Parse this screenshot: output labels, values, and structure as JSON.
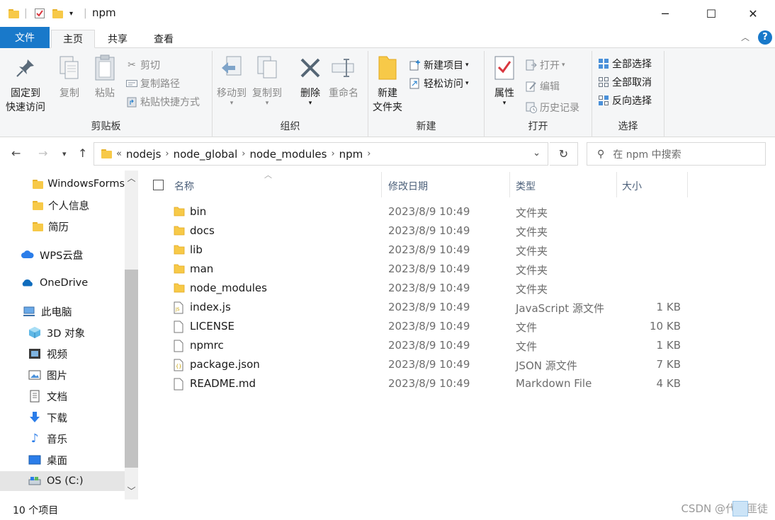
{
  "window": {
    "title": "npm",
    "controls": {
      "minimize": "─",
      "maximize": "☐",
      "close": "✕"
    }
  },
  "ribbon_tabs": [
    "文件",
    "主页",
    "共享",
    "查看"
  ],
  "ribbon": {
    "clipboard": {
      "label": "剪贴板",
      "pin_line1": "固定到",
      "pin_line2": "快速访问",
      "copy": "复制",
      "paste": "粘贴",
      "cut": "剪切",
      "copy_path": "复制路径",
      "paste_shortcut": "粘贴快捷方式"
    },
    "organize": {
      "label": "组织",
      "move_to": "移动到",
      "copy_to": "复制到",
      "delete": "删除",
      "rename": "重命名"
    },
    "new": {
      "label": "新建",
      "new_folder_line1": "新建",
      "new_folder_line2": "文件夹",
      "new_item": "新建项目",
      "easy_access": "轻松访问"
    },
    "open": {
      "label": "打开",
      "properties": "属性",
      "open": "打开",
      "edit": "编辑",
      "history": "历史记录"
    },
    "select": {
      "label": "选择",
      "select_all": "全部选择",
      "select_none": "全部取消",
      "invert": "反向选择"
    }
  },
  "address": {
    "overflow": "«",
    "crumbs": [
      "nodejs",
      "node_global",
      "node_modules",
      "npm"
    ]
  },
  "search": {
    "placeholder": "在 npm 中搜索"
  },
  "nav": [
    {
      "label": "WindowsForms",
      "icon": "folder-icon"
    },
    {
      "label": "个人信息",
      "icon": "folder-icon"
    },
    {
      "label": "简历",
      "icon": "folder-icon"
    },
    {
      "label": "WPS云盘",
      "icon": "cloud-icon"
    },
    {
      "label": "OneDrive",
      "icon": "onedrive-icon"
    },
    {
      "label": "此电脑",
      "icon": "computer-icon"
    },
    {
      "label": "3D 对象",
      "icon": "3d-objects-icon"
    },
    {
      "label": "视频",
      "icon": "video-icon"
    },
    {
      "label": "图片",
      "icon": "picture-icon"
    },
    {
      "label": "文档",
      "icon": "document-icon"
    },
    {
      "label": "下载",
      "icon": "download-icon"
    },
    {
      "label": "音乐",
      "icon": "music-icon"
    },
    {
      "label": "桌面",
      "icon": "desktop-icon"
    },
    {
      "label": "OS (C:)",
      "icon": "drive-icon"
    }
  ],
  "columns": {
    "name": "名称",
    "date": "修改日期",
    "type": "类型",
    "size": "大小"
  },
  "files": [
    {
      "name": "bin",
      "date": "2023/8/9 10:49",
      "type": "文件夹",
      "size": "",
      "kind": "folder"
    },
    {
      "name": "docs",
      "date": "2023/8/9 10:49",
      "type": "文件夹",
      "size": "",
      "kind": "folder"
    },
    {
      "name": "lib",
      "date": "2023/8/9 10:49",
      "type": "文件夹",
      "size": "",
      "kind": "folder"
    },
    {
      "name": "man",
      "date": "2023/8/9 10:49",
      "type": "文件夹",
      "size": "",
      "kind": "folder"
    },
    {
      "name": "node_modules",
      "date": "2023/8/9 10:49",
      "type": "文件夹",
      "size": "",
      "kind": "folder"
    },
    {
      "name": "index.js",
      "date": "2023/8/9 10:49",
      "type": "JavaScript 源文件",
      "size": "1 KB",
      "kind": "js"
    },
    {
      "name": "LICENSE",
      "date": "2023/8/9 10:49",
      "type": "文件",
      "size": "10 KB",
      "kind": "file"
    },
    {
      "name": "npmrc",
      "date": "2023/8/9 10:49",
      "type": "文件",
      "size": "1 KB",
      "kind": "file"
    },
    {
      "name": "package.json",
      "date": "2023/8/9 10:49",
      "type": "JSON 源文件",
      "size": "7 KB",
      "kind": "json"
    },
    {
      "name": "README.md",
      "date": "2023/8/9 10:49",
      "type": "Markdown File",
      "size": "4 KB",
      "kind": "file"
    }
  ],
  "status": {
    "count": "10 个项目"
  },
  "watermark": "CSDN @代码匪徒"
}
